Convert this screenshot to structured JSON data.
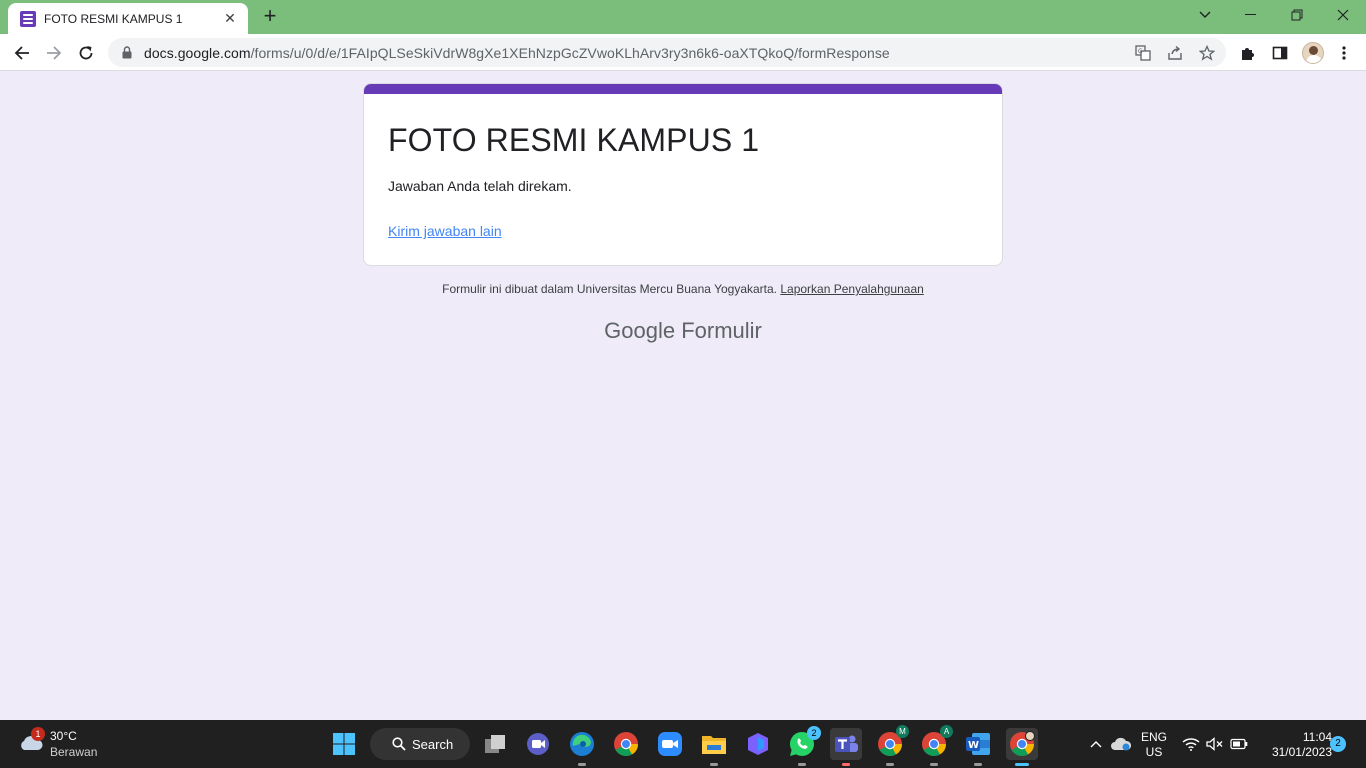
{
  "browser": {
    "tab_title": "FOTO RESMI KAMPUS 1",
    "url_host": "docs.google.com",
    "url_path": "/forms/u/0/d/e/1FAIpQLSeSkiVdrW8gXe1XEhNzpGcZVwoKLhArv3ry3n6k6-oaXTQkoQ/formResponse",
    "icons": [
      "back-icon",
      "forward-icon",
      "reload-icon",
      "lock-icon",
      "translate-icon",
      "share-icon",
      "bookmark-star-icon",
      "extensions-icon",
      "side-panel-icon",
      "profile-avatar",
      "menu-icon"
    ]
  },
  "form": {
    "title": "FOTO RESMI KAMPUS 1",
    "confirmation": "Jawaban Anda telah direkam.",
    "another_response_link": "Kirim jawaban lain",
    "accent_color": "#673ab7"
  },
  "footer": {
    "created_in": "Formulir ini dibuat dalam Universitas Mercu Buana Yogyakarta.",
    "report_link": "Laporkan Penyalahgunaan",
    "brand_google": "Google",
    "brand_product": "Formulir"
  },
  "taskbar": {
    "weather_temp": "30°C",
    "weather_desc": "Berawan",
    "weather_badge": "1",
    "search_label": "Search",
    "whatsapp_badge": "2",
    "chrome_profile_m": "M",
    "chrome_profile_a": "A",
    "language_top": "ENG",
    "language_bottom": "US",
    "time": "11:04",
    "date": "31/01/2023",
    "notification_count": "2"
  }
}
